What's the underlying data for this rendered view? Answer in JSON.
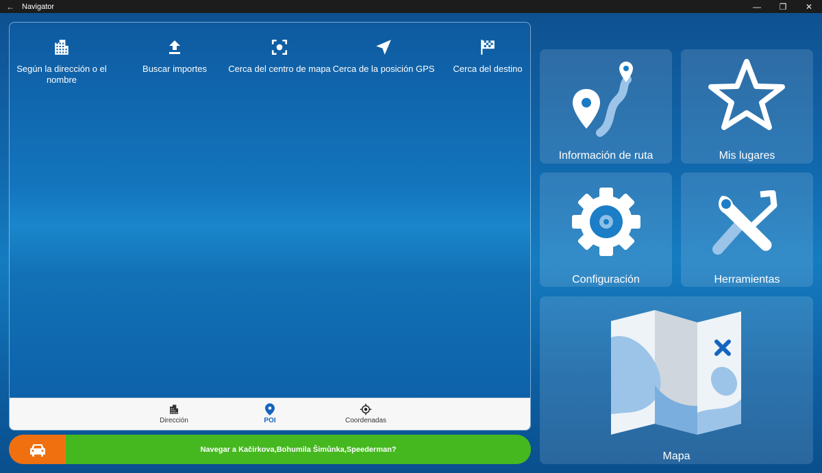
{
  "window": {
    "title": "Navigator",
    "back_glyph": "←",
    "minimize_glyph": "—",
    "restore_glyph": "❐",
    "close_glyph": "✕"
  },
  "poi_options": [
    {
      "label": "Según la dirección o el nombre",
      "icon": "building-icon"
    },
    {
      "label": "Buscar importes",
      "icon": "upload-icon"
    },
    {
      "label": "Cerca del centro de mapa",
      "icon": "map-center-icon"
    },
    {
      "label": "Cerca de la posición GPS",
      "icon": "gps-arrow-icon"
    },
    {
      "label": "Cerca del destino",
      "icon": "checkered-flag-icon"
    }
  ],
  "tabs": [
    {
      "label": "Dirección",
      "icon": "building-icon",
      "active": false
    },
    {
      "label": "POI",
      "icon": "pin-icon",
      "active": true
    },
    {
      "label": "Coordenadas",
      "icon": "crosshair-icon",
      "active": false
    }
  ],
  "navigate": {
    "label": "Navegar a Kačirkova,Bohumila Šimůnka,Speederman?",
    "icon": "car-icon"
  },
  "tiles": {
    "route_info": "Información de ruta",
    "my_places": "Mis lugares",
    "settings": "Configuración",
    "tools": "Herramientas",
    "map": "Mapa"
  },
  "colors": {
    "accent": "#1565c0",
    "navigate_green": "#45b820",
    "car_orange": "#f07010"
  }
}
